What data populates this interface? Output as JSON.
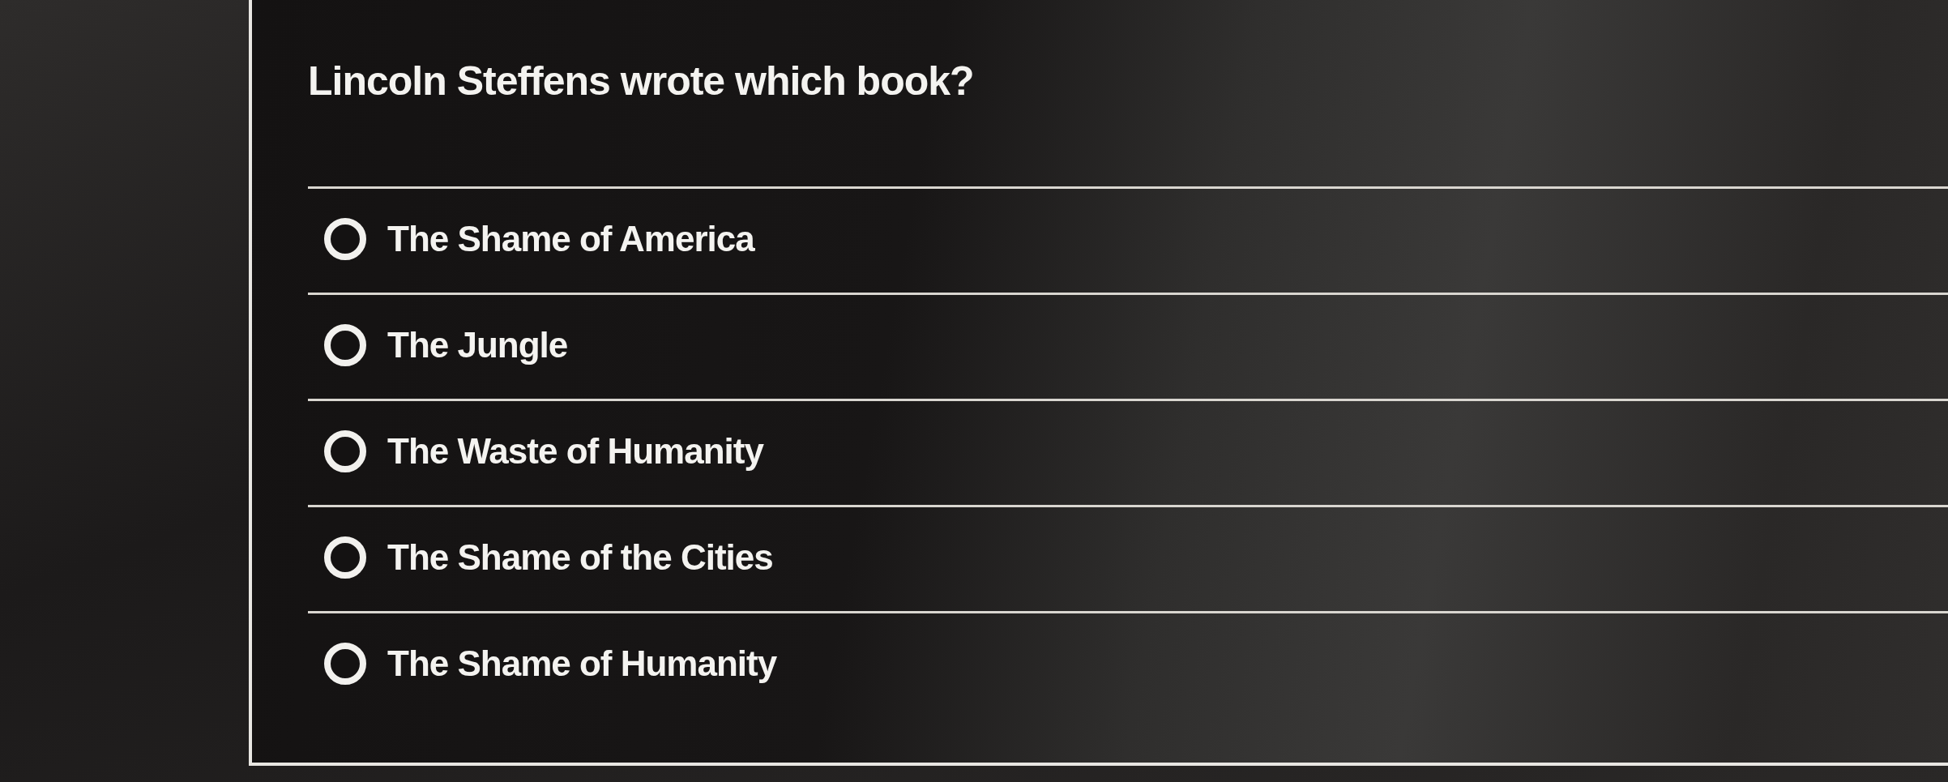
{
  "question": "Lincoln Steffens wrote which book?",
  "options": [
    {
      "label": "The Shame of America",
      "selected": false
    },
    {
      "label": "The Jungle",
      "selected": false
    },
    {
      "label": "The Waste of Humanity",
      "selected": false
    },
    {
      "label": "The Shame of the Cities",
      "selected": false
    },
    {
      "label": "The Shame of Humanity",
      "selected": false
    }
  ]
}
